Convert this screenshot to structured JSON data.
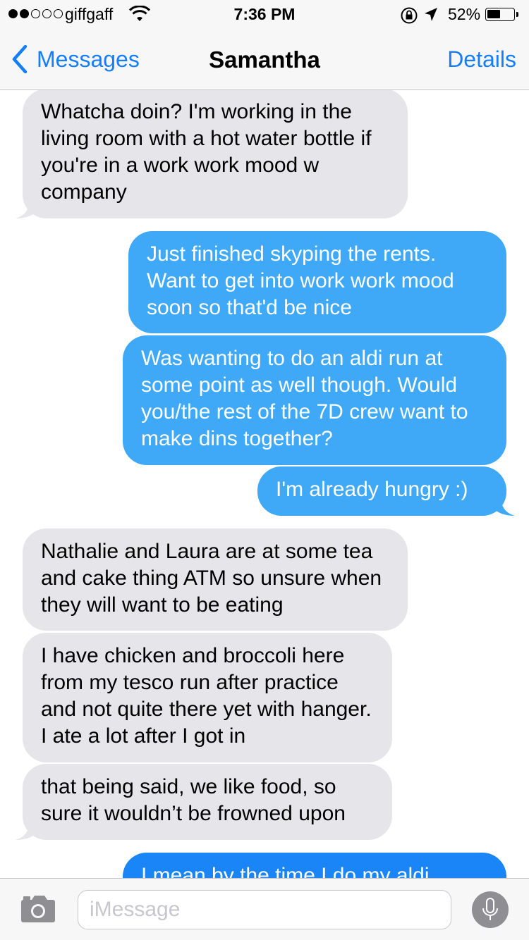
{
  "status": {
    "carrier": "giffgaff",
    "time": "7:36 PM",
    "battery_percent": "52%",
    "battery_level": 0.52,
    "signal_bars_filled": 2,
    "signal_bars_total": 5,
    "icons": [
      "wifi-icon",
      "rotation-lock-icon",
      "location-icon",
      "battery-icon"
    ]
  },
  "nav": {
    "back_label": "Messages",
    "title": "Samantha",
    "details_label": "Details"
  },
  "messages": [
    {
      "from": "them",
      "text": "Whatcha doin? I'm working in the living room with a hot water bottle if you're in a work work mood w company"
    },
    {
      "from": "me",
      "text": "Just finished skyping the rents. Want to get into work work mood soon so that'd be nice"
    },
    {
      "from": "me",
      "text": "Was wanting to do an aldi run at some point as well though. Would you/the rest of the 7D crew want to make dins together?"
    },
    {
      "from": "me",
      "text": "I'm already hungry :)"
    },
    {
      "from": "them",
      "text": "Nathalie and Laura are at some tea and cake thing ATM so unsure when they will want to be eating"
    },
    {
      "from": "them",
      "text": "I have chicken and broccoli here from my tesco run after practice and not quite there yet with hanger. I ate a lot after I got in"
    },
    {
      "from": "them",
      "text": "that being said, we like food, so sure it wouldn’t be frowned upon"
    },
    {
      "from": "me",
      "text": "I mean by the time I do my aldi"
    }
  ],
  "input": {
    "placeholder": "iMessage"
  },
  "colors": {
    "accent": "#157efb",
    "incoming_bubble": "#e5e5ea",
    "outgoing_bubble": "#3fa9f7",
    "outgoing_bubble_deep": "#1a85f6",
    "bar_background": "#f7f7f8"
  }
}
